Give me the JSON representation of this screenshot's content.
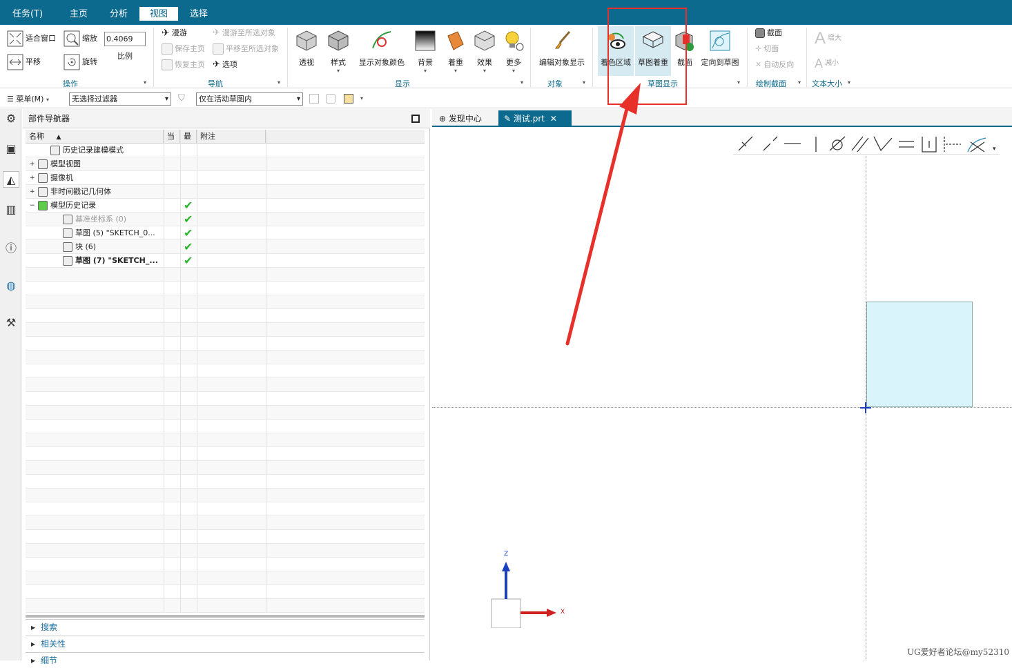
{
  "menu": {
    "tabs": [
      "任务(T)",
      "主页",
      "分析",
      "视图",
      "选择"
    ],
    "active_tab": "视图"
  },
  "ribbon": {
    "operation": {
      "fit_window": "适合窗口",
      "zoom": "缩放",
      "scale_value": "0.4069",
      "scale_label": "比例",
      "pan": "平移",
      "rotate": "旋转",
      "group_label": "操作"
    },
    "navigation": {
      "fly": "漫游",
      "save_home": "保存主页",
      "restore_home": "恢复主页",
      "fly_to_selected": "漫游至所选对象",
      "pan_to_selected": "平移至所选对象",
      "options": "选项",
      "group_label": "导航"
    },
    "display": {
      "perspective": "透视",
      "style": "样式",
      "show_object_color": "显示对象颜色",
      "background": "背景",
      "shading": "着重",
      "effects": "效果",
      "more": "更多",
      "group_label": "显示"
    },
    "object": {
      "edit_object_display": "编辑对象显示",
      "group_label": "对象"
    },
    "sketch_display": {
      "shaded_region": "着色区域",
      "sketch_emphasis": "草图着重",
      "section": "截面",
      "orient_to_sketch": "定向到草图",
      "group_label": "草图显示"
    },
    "draw_section": {
      "section": "截面",
      "cut_plane": "切面",
      "auto_reverse": "自动反向",
      "group_label": "绘制截面"
    },
    "text_size": {
      "increase": "增大",
      "decrease": "减小",
      "group_label": "文本大小"
    }
  },
  "toolbar2": {
    "menu_label": "菜单(M)",
    "filter": "无选择过滤器",
    "scope": "仅在活动草图内"
  },
  "navigator": {
    "title": "部件导航器",
    "columns": [
      "名称",
      "当",
      "最",
      "附注"
    ],
    "rows": [
      {
        "name": "历史记录建模模式",
        "check": ""
      },
      {
        "name": "模型视图",
        "check": ""
      },
      {
        "name": "摄像机",
        "check": ""
      },
      {
        "name": "非时间戳记几何体",
        "check": ""
      },
      {
        "name": "模型历史记录",
        "check": "✔"
      },
      {
        "name": "基准坐标系 (0)",
        "check": "✔"
      },
      {
        "name": "草图 (5) \"SKETCH_0...",
        "check": "✔"
      },
      {
        "name": "块 (6)",
        "check": "✔"
      },
      {
        "name": "草图 (7) \"SKETCH_...",
        "check": "✔"
      }
    ],
    "panels": [
      "搜索",
      "相关性",
      "细节"
    ]
  },
  "view_tabs": {
    "discovery": "发现中心",
    "file": "测试.prt"
  },
  "triad": {
    "z": "Z",
    "x": "X"
  },
  "watermark": "UG爱好者论坛@my52310",
  "colors": {
    "accent": "#0b6a8d",
    "highlight_box": "#e8302a",
    "sketch_fill": "#d9f5fb"
  }
}
